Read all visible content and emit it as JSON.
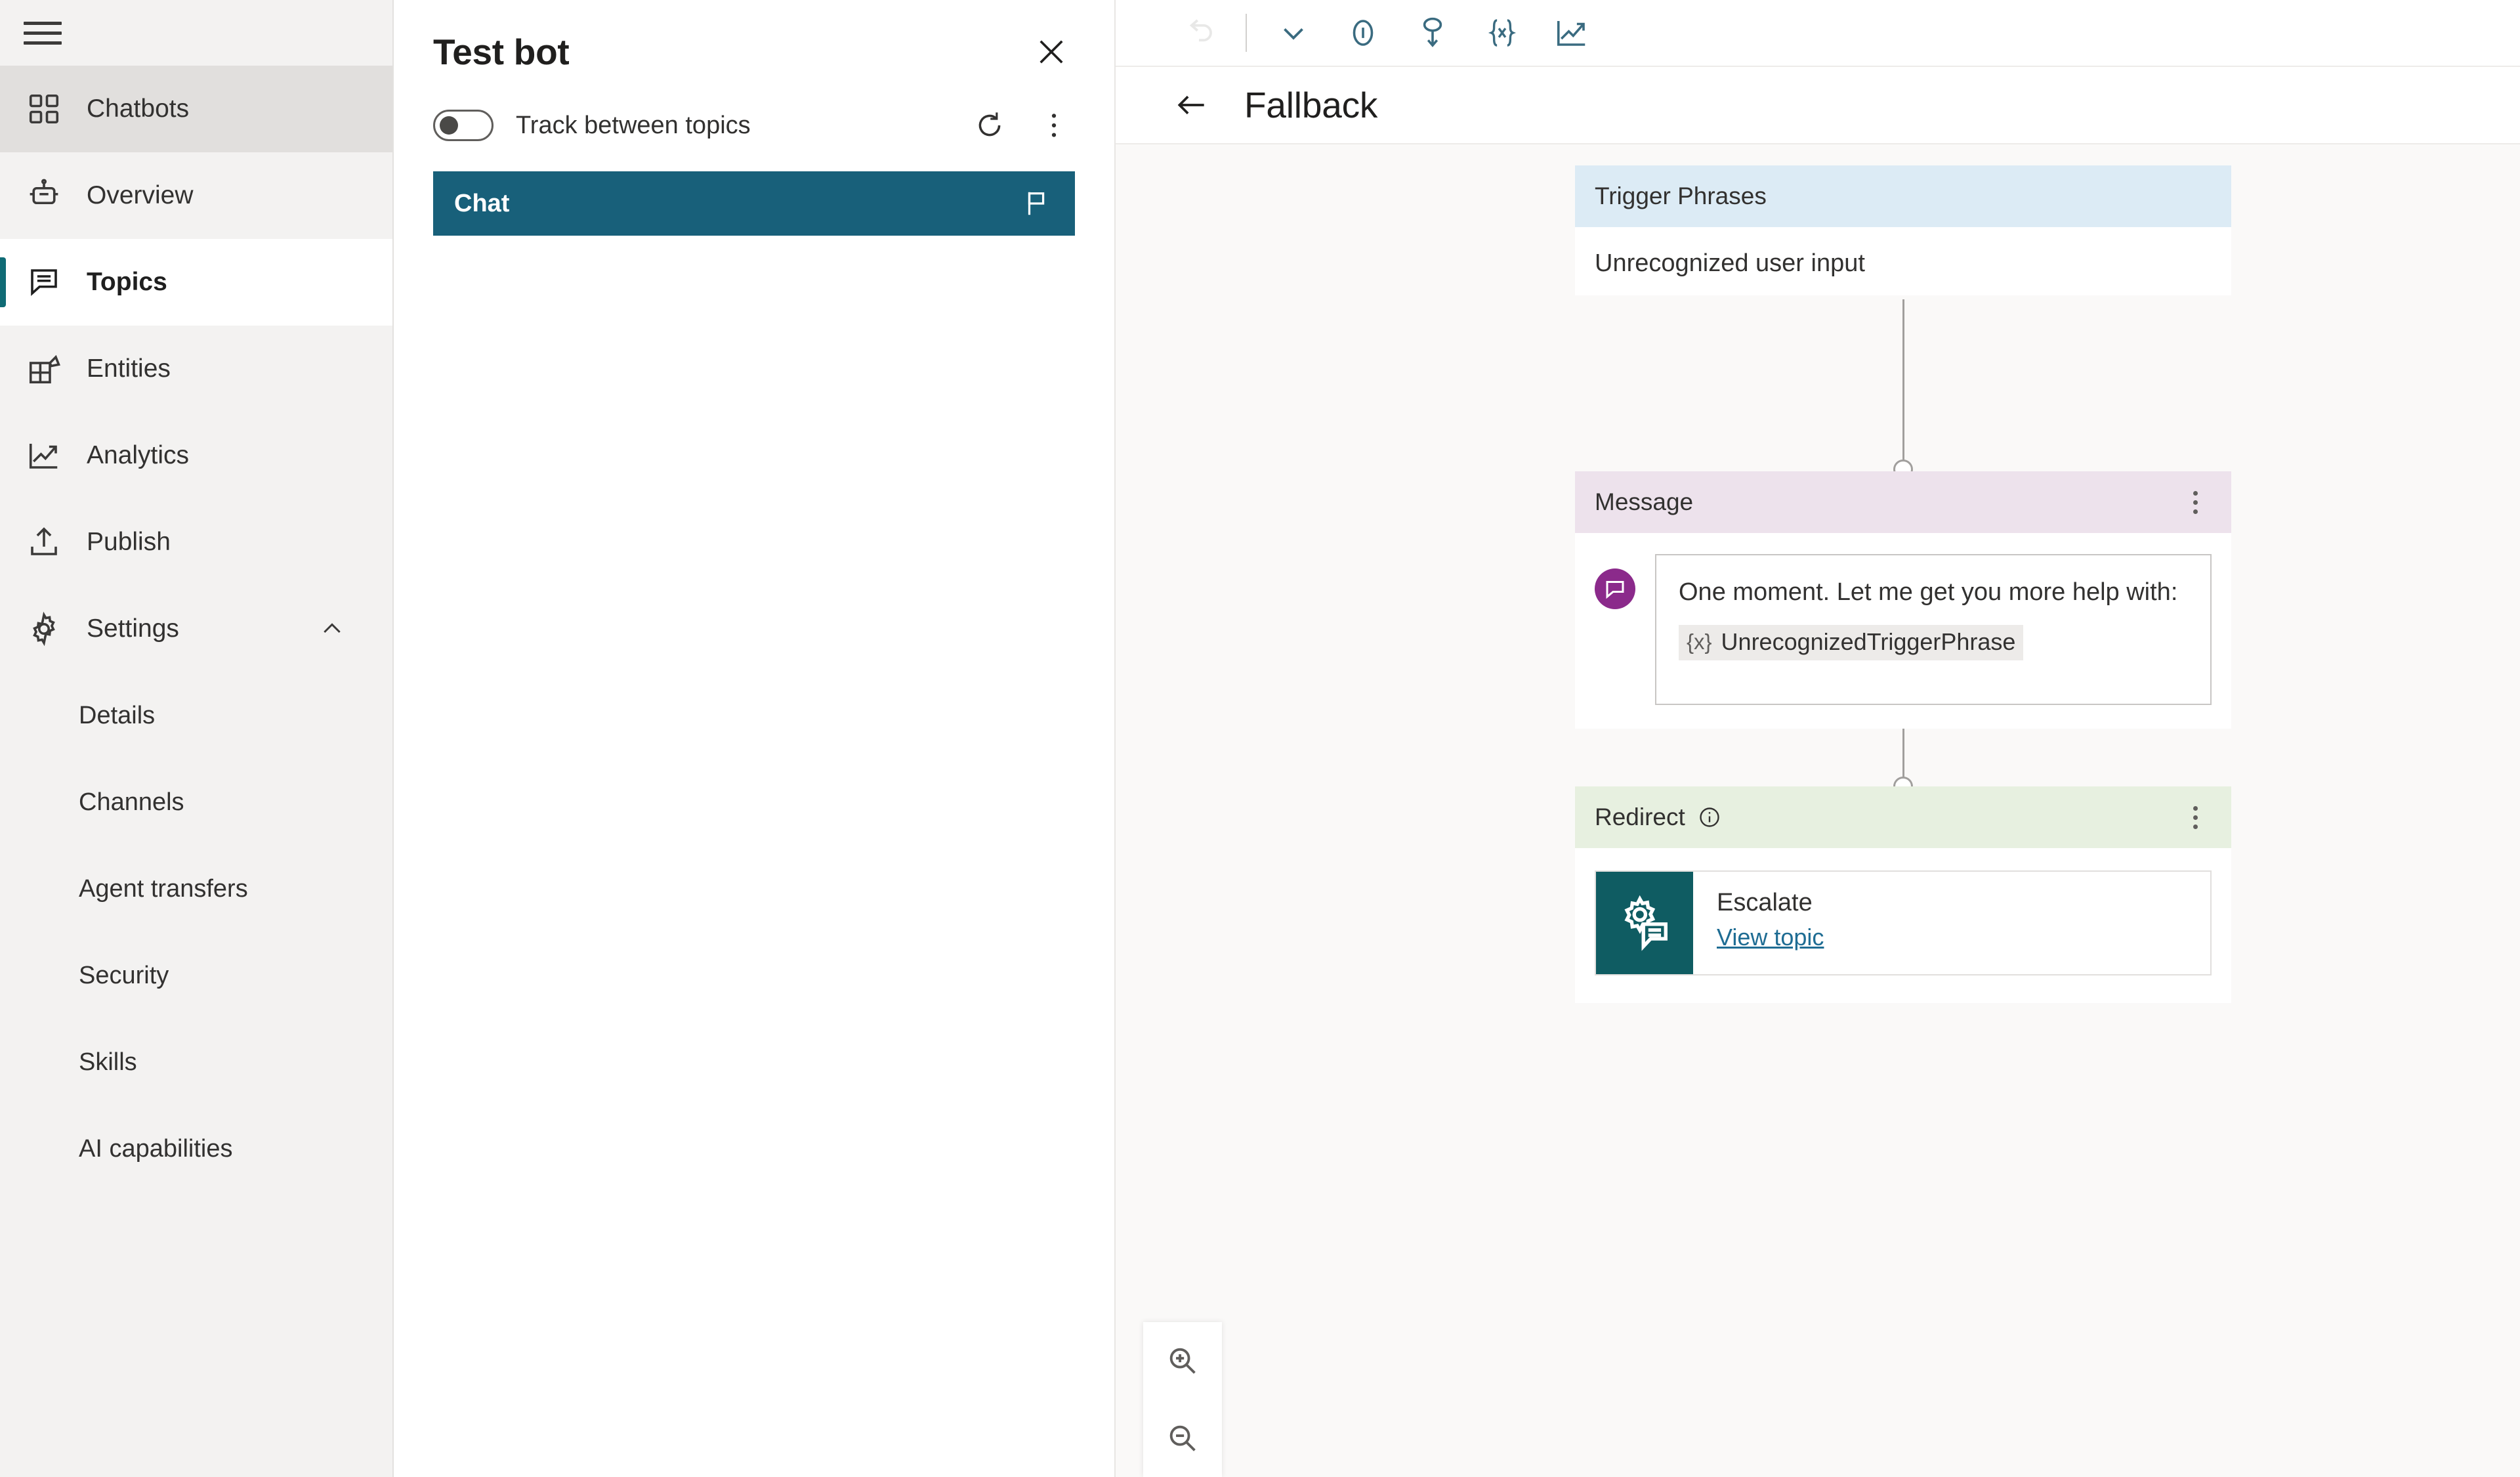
{
  "sidebar": {
    "menu_icon": "hamburger-icon",
    "items": [
      {
        "label": "Chatbots",
        "icon": "grid-icon",
        "state": "hovered"
      },
      {
        "label": "Overview",
        "icon": "bot-icon",
        "state": "normal"
      },
      {
        "label": "Topics",
        "icon": "chat-icon",
        "state": "active"
      },
      {
        "label": "Entities",
        "icon": "entities-icon",
        "state": "normal"
      },
      {
        "label": "Analytics",
        "icon": "chart-icon",
        "state": "normal"
      },
      {
        "label": "Publish",
        "icon": "upload-icon",
        "state": "normal"
      },
      {
        "label": "Settings",
        "icon": "gear-icon",
        "state": "normal",
        "expanded": true,
        "chevron": "chevron-up-icon"
      }
    ],
    "settings_children": [
      {
        "label": "Details"
      },
      {
        "label": "Channels"
      },
      {
        "label": "Agent transfers"
      },
      {
        "label": "Security"
      },
      {
        "label": "Skills"
      },
      {
        "label": "AI capabilities"
      }
    ]
  },
  "test_bot": {
    "title": "Test bot",
    "close_icon": "close-icon",
    "toggle_label": "Track between topics",
    "toggle_state": "off",
    "refresh_icon": "refresh-icon",
    "more_icon": "more-vertical-icon",
    "chat_tab_label": "Chat",
    "chat_tab_icon": "flag-icon",
    "chat_tab_color": "#18607A"
  },
  "toolbar": {
    "buttons": [
      {
        "name": "undo",
        "icon": "undo-icon",
        "disabled": true
      },
      {
        "name": "undo-dropdown",
        "icon": "chevron-down-icon",
        "disabled": false
      },
      {
        "name": "topic-checker",
        "icon": "info-circle-icon",
        "disabled": false
      },
      {
        "name": "test-topic",
        "icon": "test-pin-icon",
        "disabled": false
      },
      {
        "name": "variables",
        "icon": "variables-icon",
        "disabled": false
      },
      {
        "name": "analytics",
        "icon": "chart-up-icon",
        "disabled": false
      }
    ],
    "accent_color": "#3A6B80"
  },
  "topic_header": {
    "back_icon": "arrow-left-icon",
    "title": "Fallback"
  },
  "flow": {
    "nodes": [
      {
        "type": "trigger",
        "header": "Trigger Phrases",
        "header_color": "#DCEBF5",
        "phrase": "Unrecognized user input"
      },
      {
        "type": "message",
        "header": "Message",
        "header_color": "#EDE2EC",
        "menu_icon": "more-vertical-icon",
        "avatar_icon": "message-bubble-icon",
        "avatar_color": "#8B2A8B",
        "text": "One moment. Let me get you more help with:",
        "variable_token": "{x}",
        "variable_name": "UnrecognizedTriggerPhrase"
      },
      {
        "type": "redirect",
        "header": "Redirect",
        "header_color": "#E7F0E0",
        "header_info_icon": "info-circle-icon",
        "menu_icon": "more-vertical-icon",
        "topic_icon": "escalate-gear-chat-icon",
        "topic_thumb_color": "#0F5C62",
        "topic_name": "Escalate",
        "topic_link": "View topic"
      }
    ],
    "connector_color": "#A19F9D"
  },
  "zoom_controls": {
    "zoom_in_icon": "zoom-in-icon",
    "zoom_out_icon": "zoom-out-icon"
  }
}
